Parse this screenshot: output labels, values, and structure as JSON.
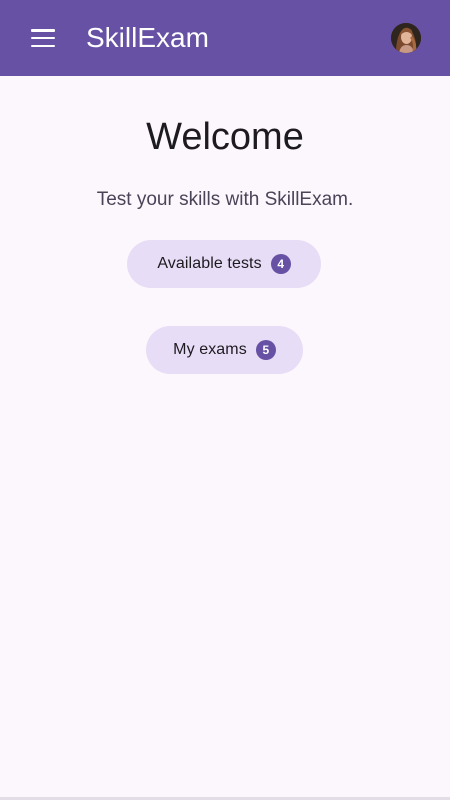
{
  "app_bar": {
    "title": "SkillExam",
    "menu_icon": "menu-icon",
    "avatar_icon": "user-avatar",
    "background_color": "#6651a4"
  },
  "main": {
    "heading": "Welcome",
    "subtitle": "Test your skills with SkillExam.",
    "buttons": [
      {
        "label": "Available tests",
        "badge": "4"
      },
      {
        "label": "My exams",
        "badge": "5"
      }
    ]
  },
  "colors": {
    "accent": "#6651a4",
    "button_background": "#e8ddf6",
    "page_background": "#fcf7fd"
  }
}
